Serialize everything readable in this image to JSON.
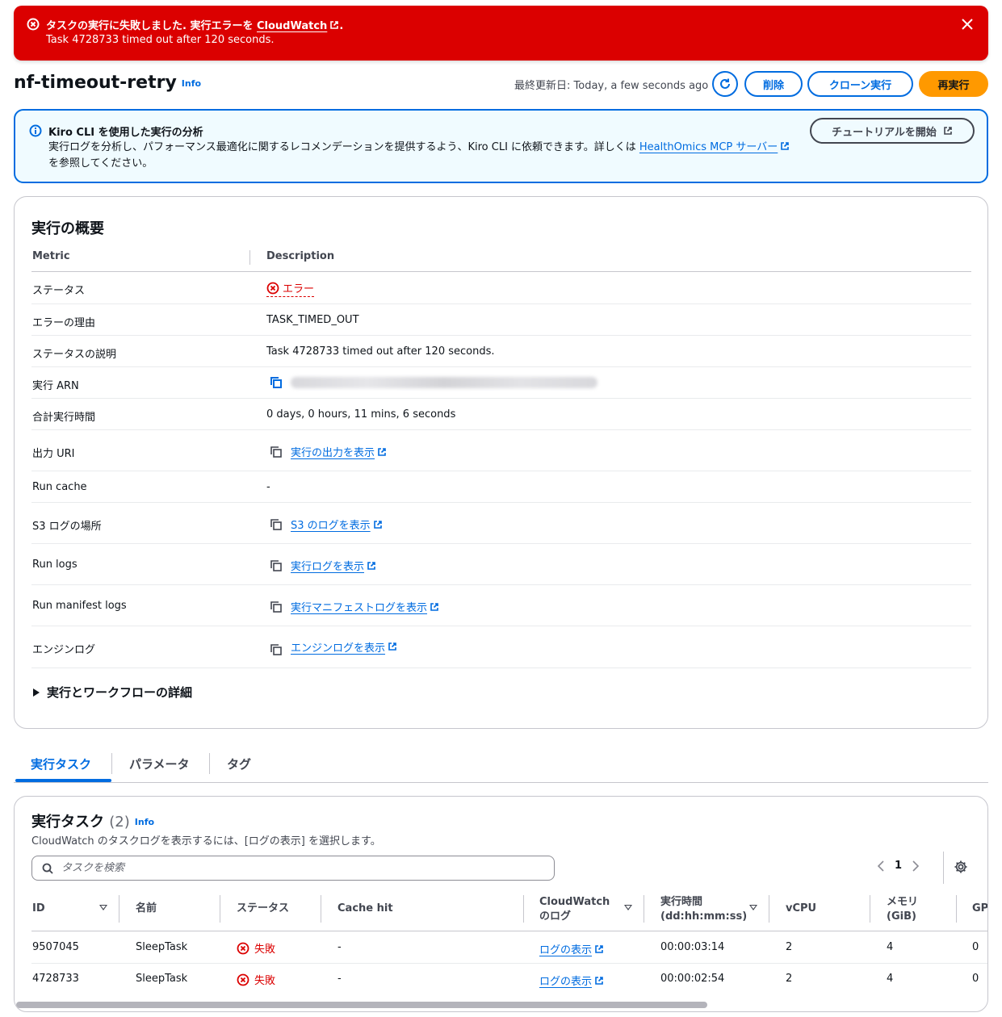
{
  "banner": {
    "message_prefix": "タスクの実行に失敗しました. 実行エラーを ",
    "link": "CloudWatch",
    "message_suffix": ".",
    "detail": "Task 4728733 timed out after 120 seconds."
  },
  "header": {
    "title": "nf-timeout-retry",
    "info": "Info",
    "last_updated": "最終更新日: Today, a few seconds ago",
    "delete": "削除",
    "clone": "クローン実行",
    "rerun": "再実行"
  },
  "alert": {
    "title": "Kiro CLI を使用した実行の分析",
    "body": "実行ログを分析し、パフォーマンス最適化に関するレコメンデーションを提供するよう、Kiro CLI に依頼できます。詳しくは ",
    "link": "HealthOmics MCP サーバー",
    "body_suffix": " を参照してください。",
    "tutorial_button": "チュートリアルを開始"
  },
  "summary": {
    "title": "実行の概要",
    "col_metric": "Metric",
    "col_description": "Description",
    "rows": {
      "status_key": "ステータス",
      "status_value": "エラー",
      "reason_key": "エラーの理由",
      "reason_value": "TASK_TIMED_OUT",
      "status_desc_key": "ステータスの説明",
      "status_desc_value": "Task 4728733 timed out after 120 seconds.",
      "arn_key": "実行 ARN",
      "duration_key": "合計実行時間",
      "duration_value": "0 days, 0 hours, 11 mins, 6 seconds",
      "output_key": "出力 URI",
      "output_link": "実行の出力を表示",
      "cache_key": "Run cache",
      "cache_value": "-",
      "s3_key": "S3 ログの場所",
      "s3_link": "S3 のログを表示",
      "runlogs_key": "Run logs",
      "runlogs_link": "実行ログを表示",
      "manifest_key": "Run manifest logs",
      "manifest_link": "実行マニフェストログを表示",
      "engine_key": "エンジンログ",
      "engine_link": "エンジンログを表示"
    },
    "expander": "実行とワークフローの詳細"
  },
  "tabs": [
    "実行タスク",
    "パラメータ",
    "タグ"
  ],
  "tasks": {
    "title": "実行タスク",
    "count": "(2)",
    "info": "Info",
    "description": "CloudWatch のタスクログを表示するには、[ログの表示] を選択します。",
    "search_placeholder": "タスクを検索",
    "page": "1",
    "columns": {
      "id": "ID",
      "name": "名前",
      "status": "ステータス",
      "cache": "Cache hit",
      "cw1": "CloudWatch",
      "cw2": "のログ",
      "time1": "実行時間",
      "time2": "(dd:hh:mm:ss)",
      "vcpu": "vCPU",
      "mem1": "メモリ",
      "mem2": "(GiB)",
      "gpu": "GP"
    },
    "rows": [
      {
        "id": "9507045",
        "name": "SleepTask",
        "status": "失敗",
        "cache": "-",
        "log": "ログの表示",
        "time": "00:00:03:14",
        "vcpu": "2",
        "mem": "4",
        "gpu": "0"
      },
      {
        "id": "4728733",
        "name": "SleepTask",
        "status": "失敗",
        "cache": "-",
        "log": "ログの表示",
        "time": "00:00:02:54",
        "vcpu": "2",
        "mem": "4",
        "gpu": "0"
      }
    ]
  },
  "colors": {
    "error": "#db0000",
    "link": "#006ce0",
    "primary": "#ff9900",
    "alert_bg": "#f0fbff"
  }
}
